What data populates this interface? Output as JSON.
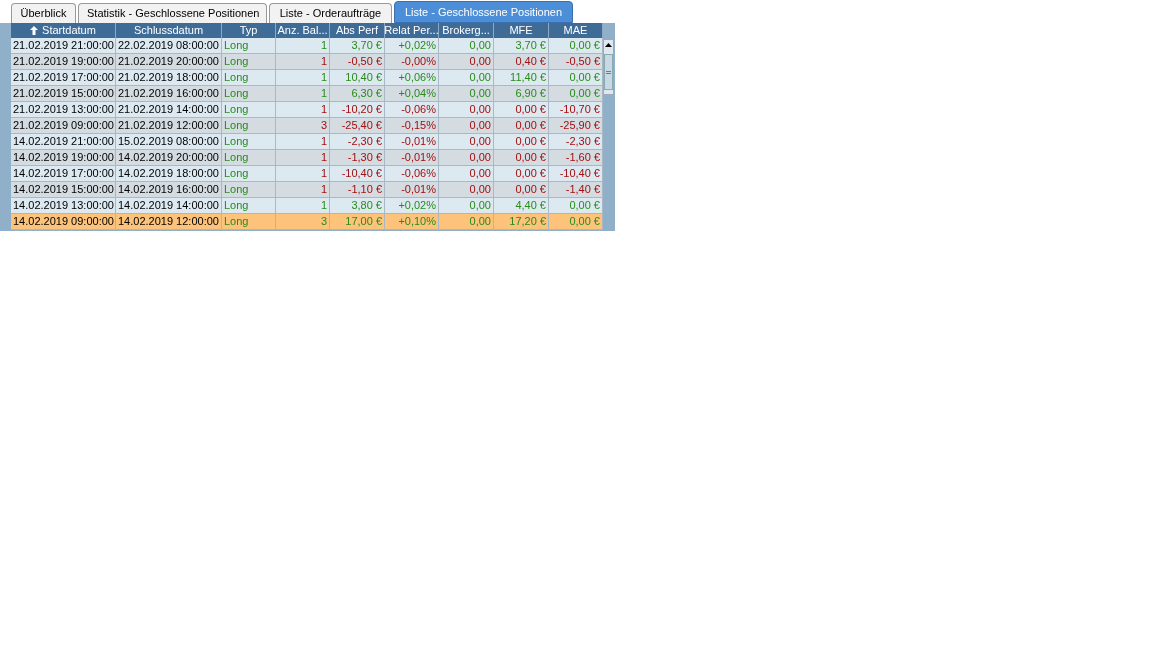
{
  "tabs": [
    {
      "label": "Überblick",
      "selected": false
    },
    {
      "label": "Statistik - Geschlossene Positionen",
      "selected": false
    },
    {
      "label": "Liste - Orderaufträge",
      "selected": false
    },
    {
      "label": "Liste - Geschlossene Positionen",
      "selected": true
    }
  ],
  "table": {
    "columns": [
      {
        "label": "Startdatum",
        "sorted": true
      },
      {
        "label": "Schlussdatum",
        "sorted": false
      },
      {
        "label": "Typ",
        "sorted": false
      },
      {
        "label": "Anz. Bal...",
        "sorted": false
      },
      {
        "label": "Abs Perf",
        "sorted": false
      },
      {
        "label": "Relat Per...",
        "sorted": false
      },
      {
        "label": "Brokerg...",
        "sorted": false
      },
      {
        "label": "MFE",
        "sorted": false
      },
      {
        "label": "MAE",
        "sorted": false
      }
    ],
    "rows": [
      {
        "kind": "gain",
        "selected": false,
        "cells": [
          "21.02.2019 21:00:00",
          "22.02.2019 08:00:00",
          "Long",
          "1",
          "3,70 €",
          "+0,02%",
          "0,00",
          "3,70 €",
          "0,00 €"
        ]
      },
      {
        "kind": "loss",
        "selected": false,
        "cells": [
          "21.02.2019 19:00:00",
          "21.02.2019 20:00:00",
          "Long",
          "1",
          "-0,50 €",
          "-0,00%",
          "0,00",
          "0,40 €",
          "-0,50 €"
        ]
      },
      {
        "kind": "gain",
        "selected": false,
        "cells": [
          "21.02.2019 17:00:00",
          "21.02.2019 18:00:00",
          "Long",
          "1",
          "10,40 €",
          "+0,06%",
          "0,00",
          "11,40 €",
          "0,00 €"
        ]
      },
      {
        "kind": "gain",
        "selected": false,
        "cells": [
          "21.02.2019 15:00:00",
          "21.02.2019 16:00:00",
          "Long",
          "1",
          "6,30 €",
          "+0,04%",
          "0,00",
          "6,90 €",
          "0,00 €"
        ]
      },
      {
        "kind": "loss",
        "selected": false,
        "cells": [
          "21.02.2019 13:00:00",
          "21.02.2019 14:00:00",
          "Long",
          "1",
          "-10,20 €",
          "-0,06%",
          "0,00",
          "0,00 €",
          "-10,70 €"
        ]
      },
      {
        "kind": "loss",
        "selected": false,
        "cells": [
          "21.02.2019 09:00:00",
          "21.02.2019 12:00:00",
          "Long",
          "3",
          "-25,40 €",
          "-0,15%",
          "0,00",
          "0,00 €",
          "-25,90 €"
        ]
      },
      {
        "kind": "loss",
        "selected": false,
        "cells": [
          "14.02.2019 21:00:00",
          "15.02.2019 08:00:00",
          "Long",
          "1",
          "-2,30 €",
          "-0,01%",
          "0,00",
          "0,00 €",
          "-2,30 €"
        ]
      },
      {
        "kind": "loss",
        "selected": false,
        "cells": [
          "14.02.2019 19:00:00",
          "14.02.2019 20:00:00",
          "Long",
          "1",
          "-1,30 €",
          "-0,01%",
          "0,00",
          "0,00 €",
          "-1,60 €"
        ]
      },
      {
        "kind": "loss",
        "selected": false,
        "cells": [
          "14.02.2019 17:00:00",
          "14.02.2019 18:00:00",
          "Long",
          "1",
          "-10,40 €",
          "-0,06%",
          "0,00",
          "0,00 €",
          "-10,40 €"
        ]
      },
      {
        "kind": "loss",
        "selected": false,
        "cells": [
          "14.02.2019 15:00:00",
          "14.02.2019 16:00:00",
          "Long",
          "1",
          "-1,10 €",
          "-0,01%",
          "0,00",
          "0,00 €",
          "-1,40 €"
        ]
      },
      {
        "kind": "gain",
        "selected": false,
        "cells": [
          "14.02.2019 13:00:00",
          "14.02.2019 14:00:00",
          "Long",
          "1",
          "3,80 €",
          "+0,02%",
          "0,00",
          "4,40 €",
          "0,00 €"
        ]
      },
      {
        "kind": "gain",
        "selected": true,
        "cells": [
          "14.02.2019 09:00:00",
          "14.02.2019 12:00:00",
          "Long",
          "3",
          "17,00 €",
          "+0,10%",
          "0,00",
          "17,20 €",
          "0,00 €"
        ]
      }
    ]
  }
}
